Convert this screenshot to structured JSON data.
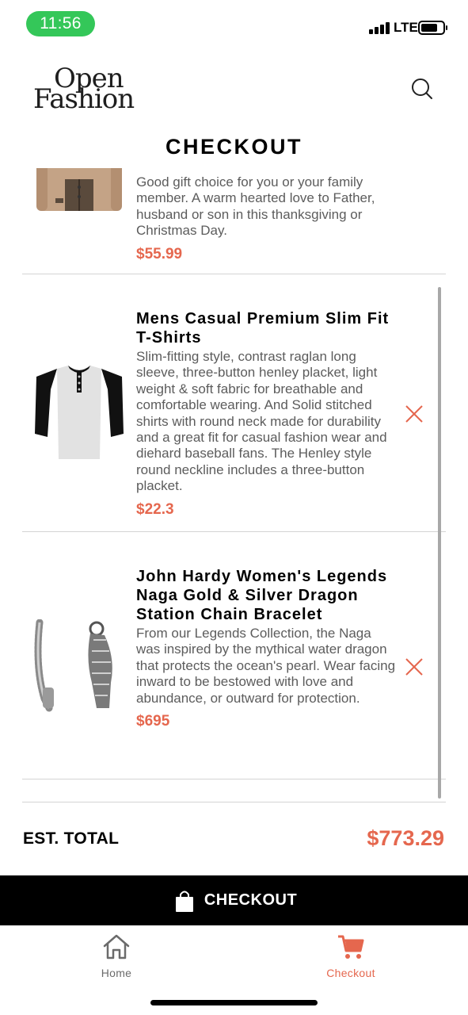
{
  "status_bar": {
    "time": "11:56",
    "network": "LTE",
    "battery_level": 0.75,
    "signal_bars": 4
  },
  "header": {
    "logo_line1": "Open",
    "logo_line2": "Fashion",
    "search_icon": "search-icon",
    "title": "CHECKOUT"
  },
  "cart": {
    "items": [
      {
        "title": "",
        "description": "Good gift choice for you or your family member. A warm hearted love to Father, husband or son in this thanksgiving or Christmas Day.",
        "price": "$55.99",
        "image_icon": "jacket-image"
      },
      {
        "title": "Mens Casual Premium Slim Fit T-Shirts",
        "description": "Slim-fitting style, contrast raglan long sleeve, three-button henley placket, light weight & soft fabric for breathable and comfortable wearing. And Solid stitched shirts with round neck made for durability and a great fit for casual fashion wear and diehard baseball fans. The Henley style round neckline includes a three-button placket.",
        "price": "$22.3",
        "image_icon": "tshirt-image"
      },
      {
        "title": "John Hardy Women's Legends Naga Gold & Silver Dragon Station Chain Bracelet",
        "description": "From our Legends Collection, the Naga was inspired by the mythical water dragon that protects the ocean's pearl. Wear facing inward to be bestowed with love and abundance, or outward for protection.",
        "price": "$695",
        "image_icon": "bracelet-image"
      }
    ],
    "remove_icon": "close-icon"
  },
  "totals": {
    "label": "EST. TOTAL",
    "value": "$773.29"
  },
  "checkout_button": {
    "label": "CHECKOUT",
    "icon": "shopping-bag-icon"
  },
  "tab_bar": {
    "tabs": [
      {
        "label": "Home",
        "icon": "home-icon",
        "active": false
      },
      {
        "label": "Checkout",
        "icon": "cart-icon",
        "active": true
      }
    ]
  },
  "colors": {
    "accent": "#e5674e",
    "status_pill": "#34c759",
    "text_secondary": "#5c5c5c",
    "divider": "#d4d4d4",
    "inactive_tab": "#6b6b6b"
  }
}
